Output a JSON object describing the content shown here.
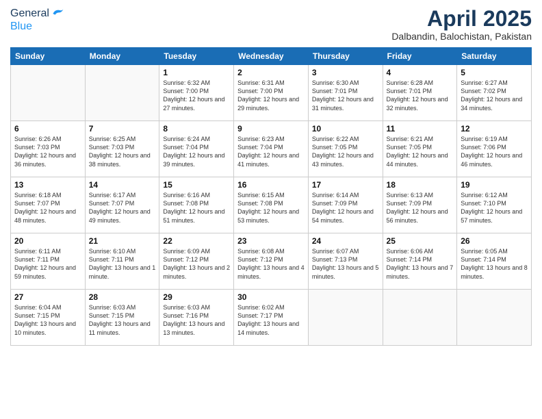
{
  "header": {
    "logo_general": "General",
    "logo_blue": "Blue",
    "month_year": "April 2025",
    "location": "Dalbandin, Balochistan, Pakistan"
  },
  "weekdays": [
    "Sunday",
    "Monday",
    "Tuesday",
    "Wednesday",
    "Thursday",
    "Friday",
    "Saturday"
  ],
  "weeks": [
    [
      {
        "day": "",
        "info": ""
      },
      {
        "day": "",
        "info": ""
      },
      {
        "day": "1",
        "info": "Sunrise: 6:32 AM\nSunset: 7:00 PM\nDaylight: 12 hours and 27 minutes."
      },
      {
        "day": "2",
        "info": "Sunrise: 6:31 AM\nSunset: 7:00 PM\nDaylight: 12 hours and 29 minutes."
      },
      {
        "day": "3",
        "info": "Sunrise: 6:30 AM\nSunset: 7:01 PM\nDaylight: 12 hours and 31 minutes."
      },
      {
        "day": "4",
        "info": "Sunrise: 6:28 AM\nSunset: 7:01 PM\nDaylight: 12 hours and 32 minutes."
      },
      {
        "day": "5",
        "info": "Sunrise: 6:27 AM\nSunset: 7:02 PM\nDaylight: 12 hours and 34 minutes."
      }
    ],
    [
      {
        "day": "6",
        "info": "Sunrise: 6:26 AM\nSunset: 7:03 PM\nDaylight: 12 hours and 36 minutes."
      },
      {
        "day": "7",
        "info": "Sunrise: 6:25 AM\nSunset: 7:03 PM\nDaylight: 12 hours and 38 minutes."
      },
      {
        "day": "8",
        "info": "Sunrise: 6:24 AM\nSunset: 7:04 PM\nDaylight: 12 hours and 39 minutes."
      },
      {
        "day": "9",
        "info": "Sunrise: 6:23 AM\nSunset: 7:04 PM\nDaylight: 12 hours and 41 minutes."
      },
      {
        "day": "10",
        "info": "Sunrise: 6:22 AM\nSunset: 7:05 PM\nDaylight: 12 hours and 43 minutes."
      },
      {
        "day": "11",
        "info": "Sunrise: 6:21 AM\nSunset: 7:05 PM\nDaylight: 12 hours and 44 minutes."
      },
      {
        "day": "12",
        "info": "Sunrise: 6:19 AM\nSunset: 7:06 PM\nDaylight: 12 hours and 46 minutes."
      }
    ],
    [
      {
        "day": "13",
        "info": "Sunrise: 6:18 AM\nSunset: 7:07 PM\nDaylight: 12 hours and 48 minutes."
      },
      {
        "day": "14",
        "info": "Sunrise: 6:17 AM\nSunset: 7:07 PM\nDaylight: 12 hours and 49 minutes."
      },
      {
        "day": "15",
        "info": "Sunrise: 6:16 AM\nSunset: 7:08 PM\nDaylight: 12 hours and 51 minutes."
      },
      {
        "day": "16",
        "info": "Sunrise: 6:15 AM\nSunset: 7:08 PM\nDaylight: 12 hours and 53 minutes."
      },
      {
        "day": "17",
        "info": "Sunrise: 6:14 AM\nSunset: 7:09 PM\nDaylight: 12 hours and 54 minutes."
      },
      {
        "day": "18",
        "info": "Sunrise: 6:13 AM\nSunset: 7:09 PM\nDaylight: 12 hours and 56 minutes."
      },
      {
        "day": "19",
        "info": "Sunrise: 6:12 AM\nSunset: 7:10 PM\nDaylight: 12 hours and 57 minutes."
      }
    ],
    [
      {
        "day": "20",
        "info": "Sunrise: 6:11 AM\nSunset: 7:11 PM\nDaylight: 12 hours and 59 minutes."
      },
      {
        "day": "21",
        "info": "Sunrise: 6:10 AM\nSunset: 7:11 PM\nDaylight: 13 hours and 1 minute."
      },
      {
        "day": "22",
        "info": "Sunrise: 6:09 AM\nSunset: 7:12 PM\nDaylight: 13 hours and 2 minutes."
      },
      {
        "day": "23",
        "info": "Sunrise: 6:08 AM\nSunset: 7:12 PM\nDaylight: 13 hours and 4 minutes."
      },
      {
        "day": "24",
        "info": "Sunrise: 6:07 AM\nSunset: 7:13 PM\nDaylight: 13 hours and 5 minutes."
      },
      {
        "day": "25",
        "info": "Sunrise: 6:06 AM\nSunset: 7:14 PM\nDaylight: 13 hours and 7 minutes."
      },
      {
        "day": "26",
        "info": "Sunrise: 6:05 AM\nSunset: 7:14 PM\nDaylight: 13 hours and 8 minutes."
      }
    ],
    [
      {
        "day": "27",
        "info": "Sunrise: 6:04 AM\nSunset: 7:15 PM\nDaylight: 13 hours and 10 minutes."
      },
      {
        "day": "28",
        "info": "Sunrise: 6:03 AM\nSunset: 7:15 PM\nDaylight: 13 hours and 11 minutes."
      },
      {
        "day": "29",
        "info": "Sunrise: 6:03 AM\nSunset: 7:16 PM\nDaylight: 13 hours and 13 minutes."
      },
      {
        "day": "30",
        "info": "Sunrise: 6:02 AM\nSunset: 7:17 PM\nDaylight: 13 hours and 14 minutes."
      },
      {
        "day": "",
        "info": ""
      },
      {
        "day": "",
        "info": ""
      },
      {
        "day": "",
        "info": ""
      }
    ]
  ]
}
